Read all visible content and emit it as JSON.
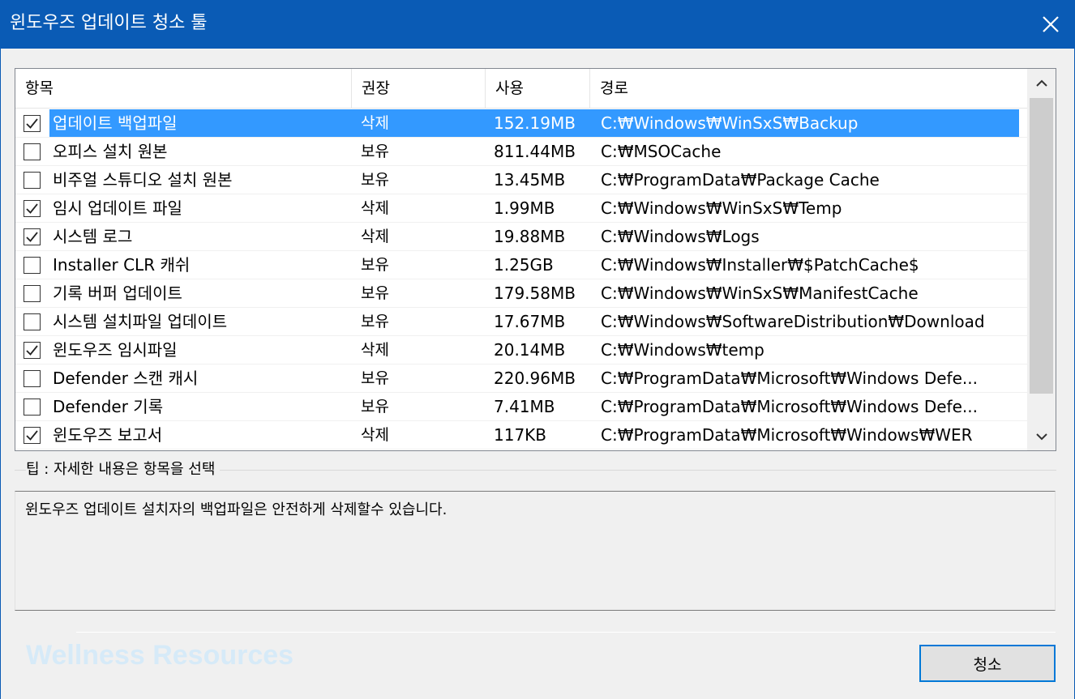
{
  "window": {
    "title": "윈도우즈 업데이트 청소 툴",
    "close_icon": "close-icon"
  },
  "table": {
    "columns": [
      "항목",
      "권장",
      "사용",
      "경로"
    ],
    "rows": [
      {
        "checked": true,
        "name": "업데이트 백업파일",
        "recommend": "삭제",
        "size": "152.19MB",
        "path": "C:₩Windows₩WinSxS₩Backup",
        "selected": true
      },
      {
        "checked": false,
        "name": "오피스 설치 원본",
        "recommend": "보유",
        "size": "811.44MB",
        "path": "C:₩MSOCache"
      },
      {
        "checked": false,
        "name": "비주얼 스튜디오 설치 원본",
        "recommend": "보유",
        "size": "13.45MB",
        "path": "C:₩ProgramData₩Package Cache"
      },
      {
        "checked": true,
        "name": "임시 업데이트 파일",
        "recommend": "삭제",
        "size": "1.99MB",
        "path": "C:₩Windows₩WinSxS₩Temp"
      },
      {
        "checked": true,
        "name": "시스템 로그",
        "recommend": "삭제",
        "size": "19.88MB",
        "path": "C:₩Windows₩Logs"
      },
      {
        "checked": false,
        "name": "Installer CLR 캐쉬",
        "recommend": "보유",
        "size": "1.25GB",
        "path": "C:₩Windows₩Installer₩$PatchCache$"
      },
      {
        "checked": false,
        "name": "기록 버퍼 업데이트",
        "recommend": "보유",
        "size": "179.58MB",
        "path": "C:₩Windows₩WinSxS₩ManifestCache"
      },
      {
        "checked": false,
        "name": "시스템 설치파일 업데이트",
        "recommend": "보유",
        "size": "17.67MB",
        "path": "C:₩Windows₩SoftwareDistribution₩Download"
      },
      {
        "checked": true,
        "name": "윈도우즈 임시파일",
        "recommend": "삭제",
        "size": "20.14MB",
        "path": "C:₩Windows₩temp"
      },
      {
        "checked": false,
        "name": "Defender 스캔 캐시",
        "recommend": "보유",
        "size": "220.96MB",
        "path": "C:₩ProgramData₩Microsoft₩Windows Defe..."
      },
      {
        "checked": false,
        "name": "Defender 기록",
        "recommend": "보유",
        "size": "7.41MB",
        "path": "C:₩ProgramData₩Microsoft₩Windows Defe..."
      },
      {
        "checked": true,
        "name": "윈도우즈 보고서",
        "recommend": "삭제",
        "size": "117KB",
        "path": "C:₩ProgramData₩Microsoft₩Windows₩WER"
      }
    ]
  },
  "tip": {
    "label": "팁 : 자세한 내용은 항목을 선택",
    "text": "윈도우즈 업데이트 설치자의 백업파일은 안전하게 삭제할수 있습니다."
  },
  "watermark": "Wellness Resources",
  "buttons": {
    "clean_label": "청소"
  },
  "colors": {
    "titlebar": "#0a5bb5",
    "selection": "#3399ff",
    "button_border": "#0078d7"
  }
}
